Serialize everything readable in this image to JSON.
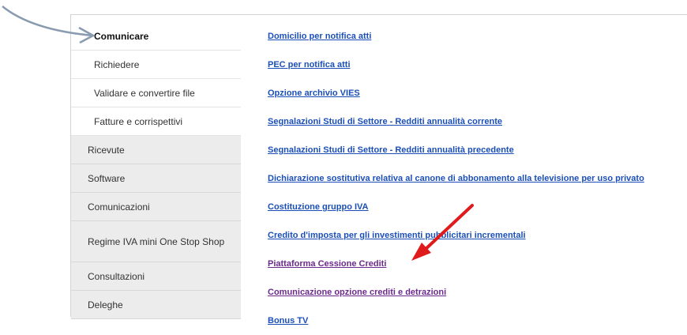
{
  "sidebar": {
    "sub_items": [
      {
        "label": "Comunicare"
      },
      {
        "label": "Richiedere"
      },
      {
        "label": "Validare e convertire file"
      },
      {
        "label": "Fatture e corrispettivi"
      }
    ],
    "main_items": [
      {
        "label": "Ricevute"
      },
      {
        "label": "Software"
      },
      {
        "label": "Comunicazioni"
      },
      {
        "label": "Regime IVA mini One Stop Shop"
      },
      {
        "label": "Consultazioni"
      },
      {
        "label": "Deleghe"
      }
    ]
  },
  "links": [
    {
      "label": "Domicilio per notifica atti"
    },
    {
      "label": "PEC per notifica atti"
    },
    {
      "label": "Opzione archivio VIES"
    },
    {
      "label": "Segnalazioni Studi di Settore - Redditi annualità corrente"
    },
    {
      "label": "Segnalazioni Studi di Settore - Redditi annualità precedente"
    },
    {
      "label": "Dichiarazione sostitutiva relativa al canone di abbonamento alla televisione per uso privato"
    },
    {
      "label": "Costituzione gruppo IVA"
    },
    {
      "label": "Credito d'imposta per gli investimenti pubblicitari incrementali"
    },
    {
      "label": "Piattaforma Cessione Crediti"
    },
    {
      "label": "Comunicazione opzione crediti e detrazioni"
    },
    {
      "label": "Bonus TV"
    }
  ],
  "colors": {
    "link": "#1b4fb8",
    "link_visited": "#6b2a8c",
    "annotation_arrow_red": "#e01b1b",
    "annotation_arrow_gray": "#8a9bb0"
  }
}
